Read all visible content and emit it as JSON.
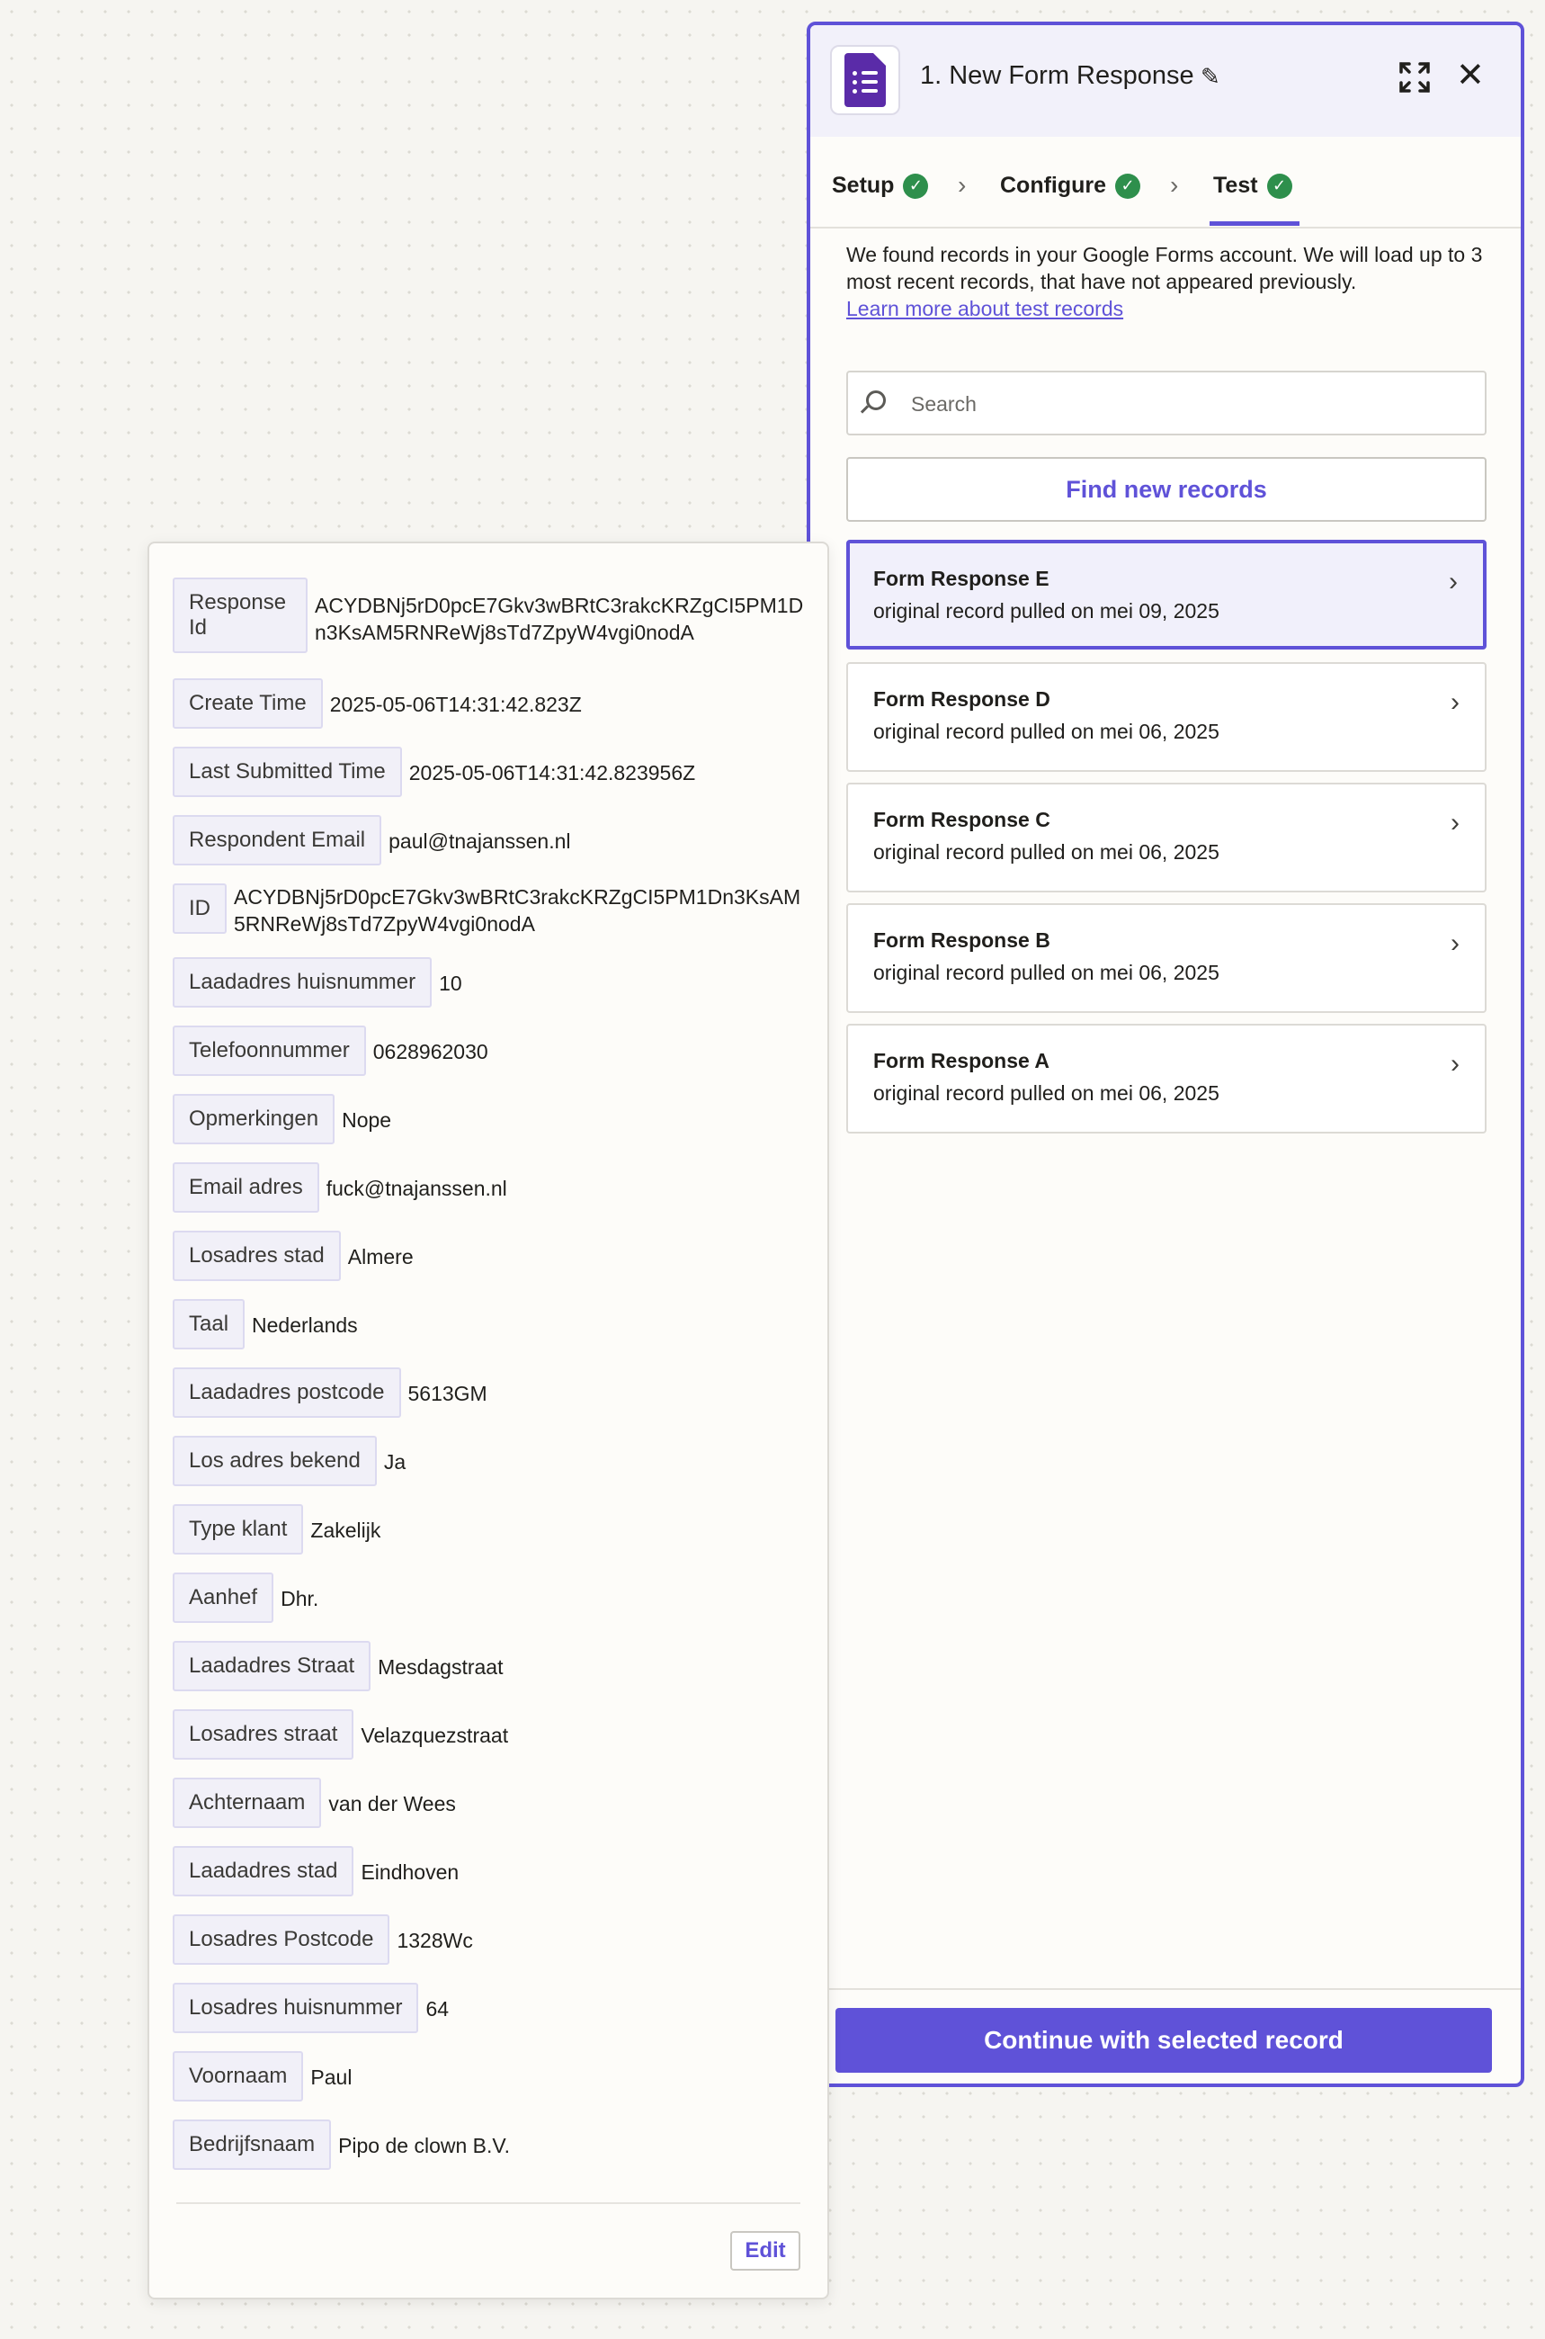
{
  "panel": {
    "title": "1. New Form Response",
    "app_icon": "google-forms-icon",
    "tabs": [
      {
        "label": "Setup",
        "status": "complete"
      },
      {
        "label": "Configure",
        "status": "complete"
      },
      {
        "label": "Test",
        "status": "complete",
        "active": true
      }
    ],
    "intro_text": "We found records in your Google Forms account. We will load up to 3 most recent records, that have not appeared previously.",
    "learn_more_link": "Learn more about test records",
    "search_placeholder": "Search",
    "find_button": "Find new records",
    "records": [
      {
        "title": "Form Response E",
        "subtitle": "original record pulled on mei 09, 2025",
        "selected": true
      },
      {
        "title": "Form Response D",
        "subtitle": "original record pulled on mei 06, 2025",
        "selected": false
      },
      {
        "title": "Form Response C",
        "subtitle": "original record pulled on mei 06, 2025",
        "selected": false
      },
      {
        "title": "Form Response B",
        "subtitle": "original record pulled on mei 06, 2025",
        "selected": false
      },
      {
        "title": "Form Response A",
        "subtitle": "original record pulled on mei 06, 2025",
        "selected": false
      }
    ],
    "continue_button": "Continue with selected record"
  },
  "record_detail": {
    "fields": [
      {
        "label": "Response Id",
        "value": "ACYDBNj5rD0pcE7Gkv3wBRtC3rakcKRZgCI5PM1Dn3KsAM5RNReWj8sTd7ZpyW4vgi0nodA"
      },
      {
        "label": "Create Time",
        "value": "2025-05-06T14:31:42.823Z"
      },
      {
        "label": "Last Submitted Time",
        "value": "2025-05-06T14:31:42.823956Z"
      },
      {
        "label": "Respondent Email",
        "value": "paul@tnajanssen.nl"
      },
      {
        "label": "ID",
        "value": "ACYDBNj5rD0pcE7Gkv3wBRtC3rakcKRZgCI5PM1Dn3KsAM5RNReWj8sTd7ZpyW4vgi0nodA"
      },
      {
        "label": "Laadadres huisnummer",
        "value": "10"
      },
      {
        "label": "Telefoonnummer",
        "value": "0628962030"
      },
      {
        "label": "Opmerkingen",
        "value": "Nope"
      },
      {
        "label": "Email adres",
        "value": "fuck@tnajanssen.nl"
      },
      {
        "label": "Losadres stad",
        "value": "Almere"
      },
      {
        "label": "Taal",
        "value": "Nederlands"
      },
      {
        "label": "Laadadres postcode",
        "value": "5613GM"
      },
      {
        "label": "Los adres bekend",
        "value": "Ja"
      },
      {
        "label": "Type klant",
        "value": "Zakelijk"
      },
      {
        "label": "Aanhef",
        "value": "Dhr."
      },
      {
        "label": "Laadadres Straat",
        "value": "Mesdagstraat"
      },
      {
        "label": "Losadres straat",
        "value": "Velazquezstraat"
      },
      {
        "label": "Achternaam",
        "value": "van der Wees"
      },
      {
        "label": "Laadadres stad",
        "value": "Eindhoven"
      },
      {
        "label": "Losadres Postcode",
        "value": "1328Wc"
      },
      {
        "label": "Losadres huisnummer",
        "value": "64"
      },
      {
        "label": "Voornaam",
        "value": "Paul"
      },
      {
        "label": "Bedrijfsnaam",
        "value": "Pipo de clown B.V."
      }
    ],
    "edit_button": "Edit"
  },
  "colors": {
    "accent": "#5f52d8",
    "success": "#2e8f4c",
    "forms_purple": "#5a2ba8"
  }
}
